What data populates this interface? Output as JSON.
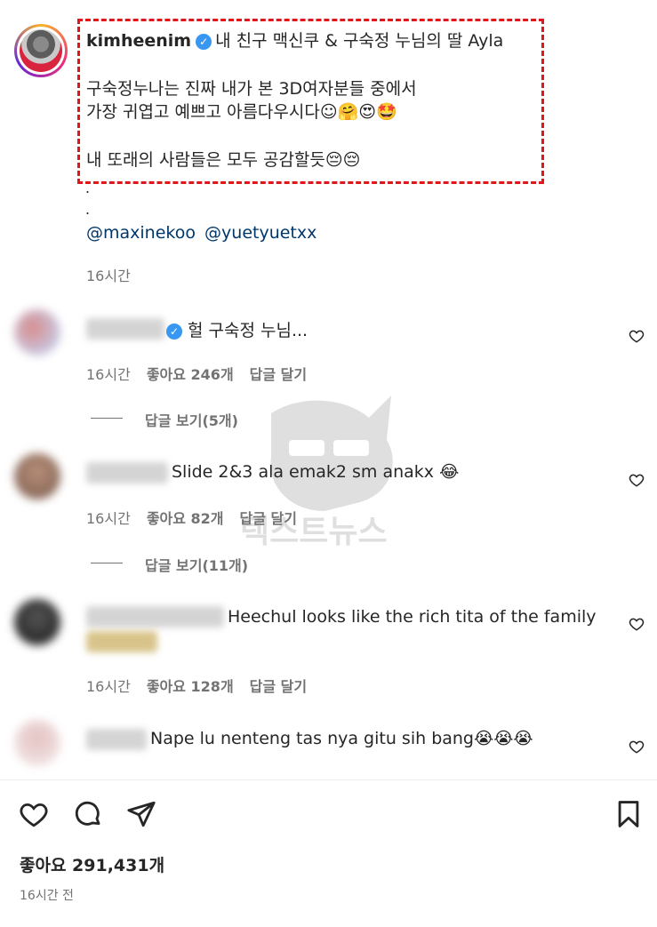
{
  "post": {
    "username": "kimheenim",
    "verified_mark": "✓",
    "caption_line1": "내 친구 맥신쿠 & 구숙정 누님의 딸 Ayla",
    "caption_line2": "구숙정누나는 진짜 내가 본 3D여자분들 중에서",
    "caption_line3": "가장 귀엽고 예쁘고 아름다우시다☺🤗😍🤩",
    "caption_line4": "내 또래의 사람들은 모두 공감할듯😔😔",
    "dot1": ".",
    "dot2": ".",
    "mentions": [
      "@maxinekoo",
      "@yuetyuetxx"
    ],
    "time": "16시간"
  },
  "comments": [
    {
      "text": "헐 구숙정 누님...",
      "verified": true,
      "time": "16시간",
      "likes": "좋아요 246개",
      "reply_label": "답글 달기",
      "view_replies": "답글 보기(5개)"
    },
    {
      "text": "Slide 2&3 ala emak2 sm anakx 😂",
      "time": "16시간",
      "likes": "좋아요 82개",
      "reply_label": "답글 달기",
      "view_replies": "답글 보기(11개)"
    },
    {
      "text": "Heechul looks like the rich tita of the family",
      "time": "16시간",
      "likes": "좋아요 128개",
      "reply_label": "답글 달기"
    },
    {
      "text": "Nape lu nenteng tas nya gitu sih bang😭😭😭"
    }
  ],
  "watermark_text": "텍스트뉴스",
  "footer": {
    "likes": "좋아요 291,431개",
    "time": "16시간 전"
  },
  "icons": {
    "like": "heart-icon",
    "comment": "comment-icon",
    "share": "share-icon",
    "save": "bookmark-icon"
  },
  "colors": {
    "highlight": "#e0161b",
    "verified": "#3897f0",
    "mention": "#00376b",
    "muted": "#737373"
  }
}
